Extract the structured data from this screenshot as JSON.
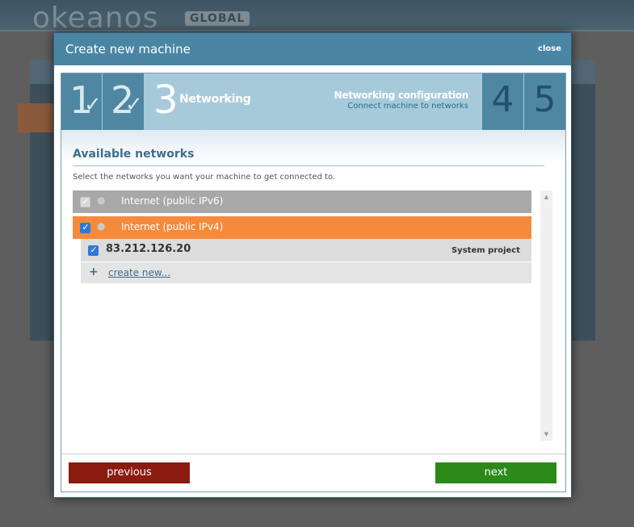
{
  "background": {
    "logo": "okeanos",
    "logo_badge": "GLOBAL"
  },
  "modal": {
    "title": "Create new machine",
    "close_label": "close"
  },
  "steps": {
    "items": [
      {
        "number": "1",
        "state": "done"
      },
      {
        "number": "2",
        "state": "done"
      },
      {
        "number": "3",
        "state": "current",
        "label": "Networking"
      },
      {
        "number": "4",
        "state": "future"
      },
      {
        "number": "5",
        "state": "future"
      }
    ],
    "done_mark": "✓",
    "info_title": "Networking configuration",
    "info_subtitle": "Connect machine to networks"
  },
  "networks": {
    "title": "Available networks",
    "description": "Select the networks you want your machine to get connected to.",
    "items": [
      {
        "name": "Internet (public IPv6)",
        "checked": true,
        "disabled": true
      },
      {
        "name": "Internet (public IPv4)",
        "checked": true,
        "disabled": false
      }
    ],
    "ips": [
      {
        "address": "83.212.126.20",
        "project": "System project",
        "checked": true
      }
    ],
    "create_plus": "+",
    "create_label": "create new..."
  },
  "footer": {
    "previous_label": "previous",
    "next_label": "next"
  },
  "colors": {
    "header": "#4a86a4",
    "steps_bg": "#a7cadb",
    "ipv4_row": "#f58a3c",
    "ipv6_row": "#a8a8a8",
    "previous_button": "#8b1a10",
    "next_button": "#2b8a1a"
  }
}
